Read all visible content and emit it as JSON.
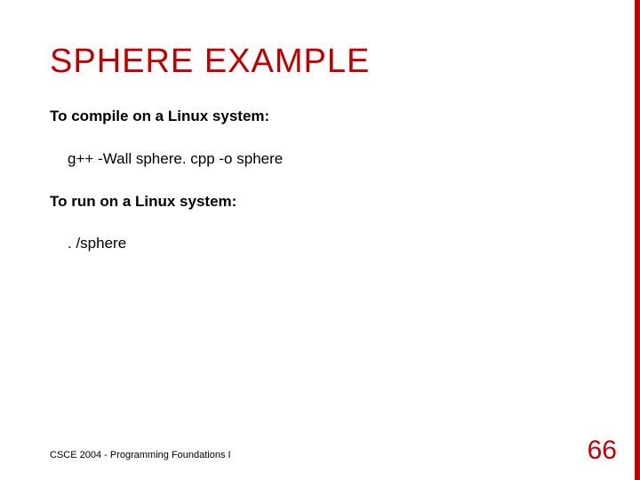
{
  "title": "SPHERE EXAMPLE",
  "body": {
    "line1": "To compile on a Linux system:",
    "line2": "g++ -Wall sphere. cpp -o sphere",
    "line3": "To run on a Linux system:",
    "line4": ". /sphere"
  },
  "footer": "CSCE 2004 - Programming Foundations I",
  "page_number": "66",
  "colors": {
    "accent": "#c00000"
  }
}
